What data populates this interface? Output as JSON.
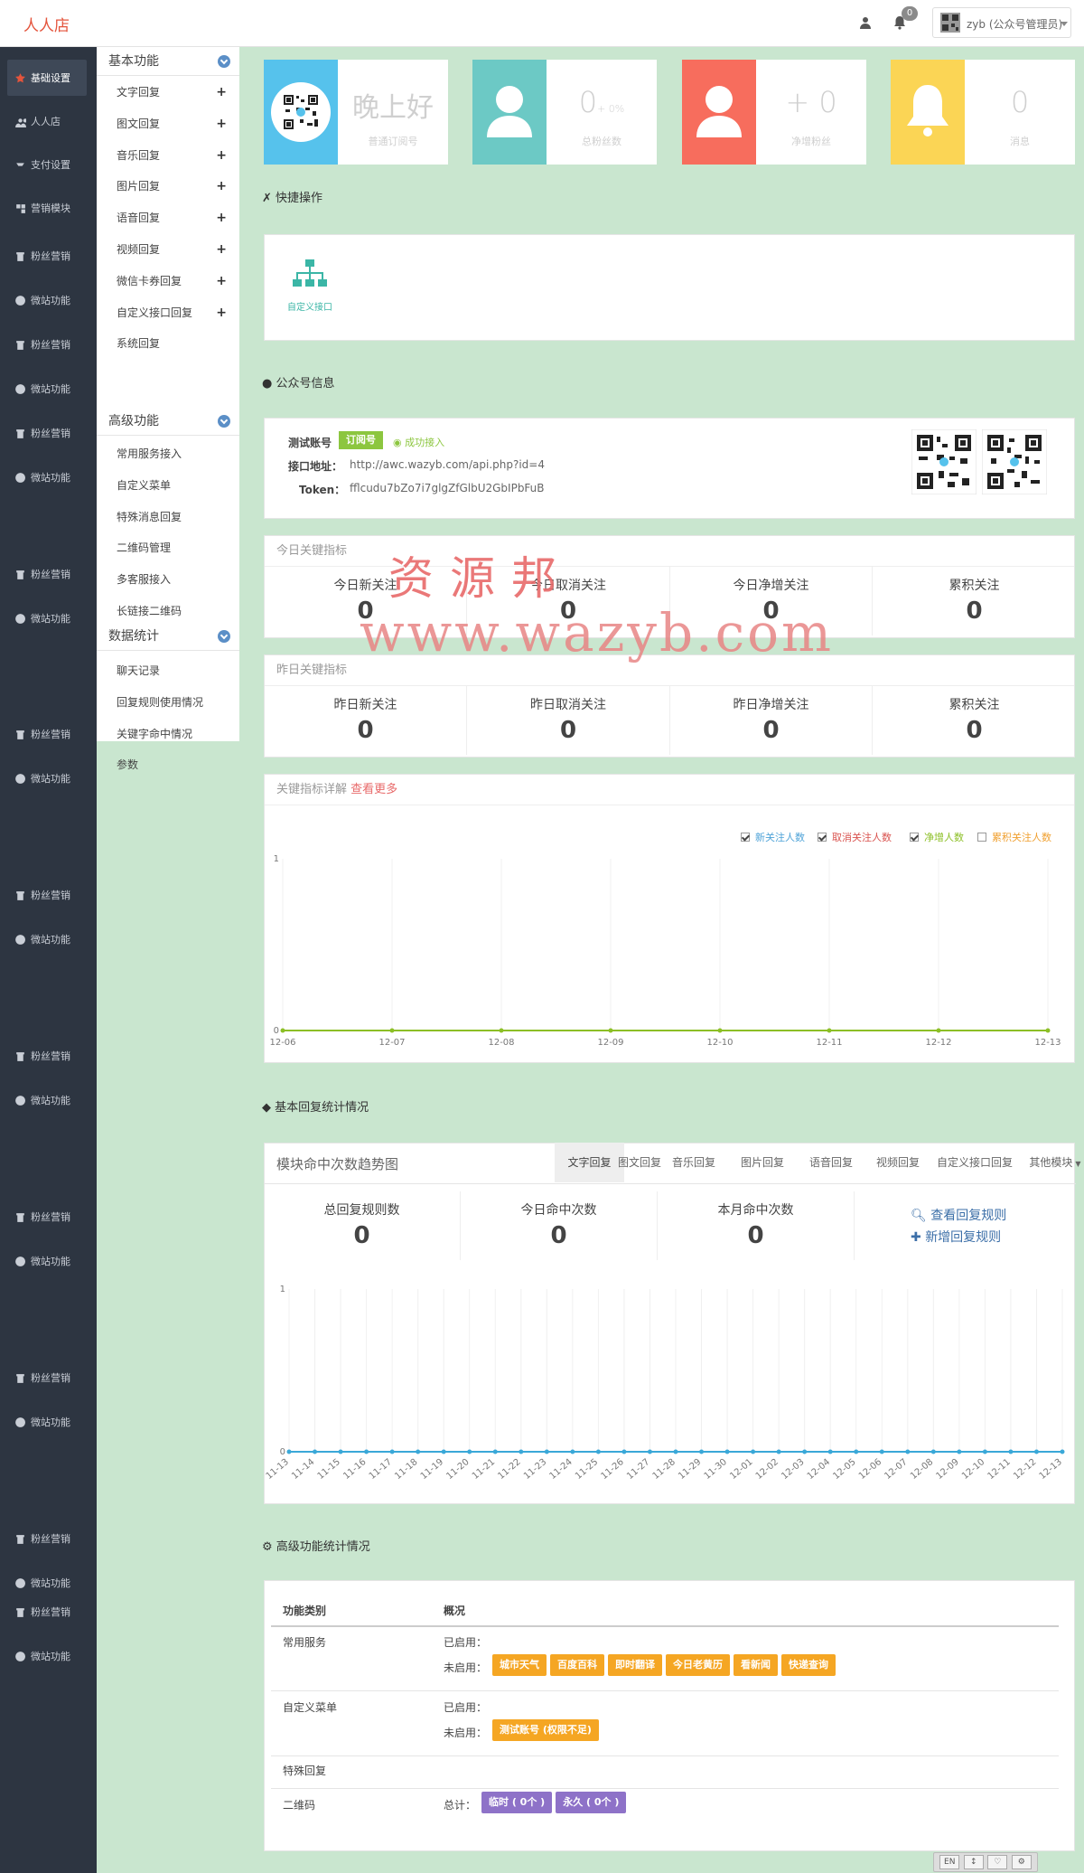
{
  "brand": "人人店",
  "header": {
    "notifications": "0",
    "user": "zyb (公众号管理员)"
  },
  "sidebar": {
    "items": [
      "基础设置",
      "人人店",
      "支付设置",
      "营销模块",
      "粉丝营销",
      "微站功能",
      "粉丝营销",
      "微站功能",
      "粉丝营销",
      "微站功能",
      "粉丝营销",
      "微站功能",
      "粉丝营销",
      "微站功能",
      "粉丝营销",
      "微站功能",
      "粉丝营销",
      "微站功能",
      "粉丝营销",
      "微站功能",
      "粉丝营销",
      "微站功能",
      "粉丝营销",
      "微站功能",
      "粉丝营销",
      "微站功能"
    ]
  },
  "submenu": {
    "groups": [
      {
        "title": "基本功能",
        "items": [
          "文字回复",
          "图文回复",
          "音乐回复",
          "图片回复",
          "语音回复",
          "视频回复",
          "微信卡券回复",
          "自定义接口回复",
          "系统回复"
        ]
      },
      {
        "title": "高级功能",
        "items": [
          "常用服务接入",
          "自定义菜单",
          "特殊消息回复",
          "二维码管理",
          "多客服接入",
          "长链接二维码"
        ]
      },
      {
        "title": "数据统计",
        "items": [
          "聊天记录",
          "回复规则使用情况",
          "关键字命中情况",
          "参数"
        ]
      }
    ]
  },
  "cards": {
    "greeting": {
      "value": "晚上好",
      "label": "普通订阅号"
    },
    "fans": {
      "value": "0",
      "sub": "+ 0%",
      "label": "总粉丝数"
    },
    "net": {
      "value": "+ 0",
      "label": "净增粉丝"
    },
    "msg": {
      "value": "0",
      "label": "消息"
    },
    "colors": {
      "blue": "#56c2ec",
      "teal": "#6cc9c5",
      "red": "#f76d5d",
      "yellow": "#fbd555"
    }
  },
  "quick": {
    "title": "快捷操作",
    "item": "自定义接口"
  },
  "account": {
    "title": "公众号信息",
    "name_label": "测试账号",
    "type_badge": "订阅号",
    "status": "成功接入",
    "url_label": "接口地址：",
    "url": "http://awc.wazyb.com/api.php?id=4",
    "token_label": "Token：",
    "token": "fflcudu7bZo7i7glgZfGlbU2GbIPbFuB"
  },
  "watermark": {
    "line1": "资源邦",
    "line2": "www.wazyb.com"
  },
  "today": {
    "title": "今日关键指标",
    "items": [
      {
        "label": "今日新关注",
        "value": "0"
      },
      {
        "label": "今日取消关注",
        "value": "0"
      },
      {
        "label": "今日净增关注",
        "value": "0"
      },
      {
        "label": "累积关注",
        "value": "0"
      }
    ]
  },
  "yesterday": {
    "title": "昨日关键指标",
    "items": [
      {
        "label": "昨日新关注",
        "value": "0"
      },
      {
        "label": "昨日取消关注",
        "value": "0"
      },
      {
        "label": "昨日净增关注",
        "value": "0"
      },
      {
        "label": "累积关注",
        "value": "0"
      }
    ]
  },
  "detail": {
    "title": "关键指标详解",
    "more": "查看更多",
    "legend": [
      {
        "label": "新关注人数",
        "checked": true,
        "color": "#4fa3d8"
      },
      {
        "label": "取消关注人数",
        "checked": true,
        "color": "#d9534f"
      },
      {
        "label": "净增人数",
        "checked": true,
        "color": "#8cbf26"
      },
      {
        "label": "累积关注人数",
        "checked": false,
        "color": "#f0a030"
      }
    ]
  },
  "reply_stats": {
    "section_title": "基本回复统计情况",
    "panel_title": "模块命中次数趋势图",
    "tabs": [
      "文字回复",
      "图文回复",
      "音乐回复",
      "图片回复",
      "语音回复",
      "视频回复",
      "自定义接口回复",
      "其他模块"
    ],
    "cells": [
      {
        "label": "总回复规则数",
        "value": "0"
      },
      {
        "label": "今日命中次数",
        "value": "0"
      },
      {
        "label": "本月命中次数",
        "value": "0"
      }
    ],
    "links": [
      "查看回复规则",
      "新增回复规则"
    ]
  },
  "advanced": {
    "title": "高级功能统计情况",
    "col1": "功能类别",
    "col2": "概况",
    "rows": [
      {
        "category": "常用服务",
        "enabled_label": "已启用：",
        "disabled_label": "未启用：",
        "tags": [
          "城市天气",
          "百度百科",
          "即时翻译",
          "今日老黄历",
          "看新闻",
          "快递查询"
        ]
      },
      {
        "category": "自定义菜单",
        "enabled_label": "已启用：",
        "disabled_label": "未启用：",
        "tags": [
          "测试账号 (权限不足)"
        ]
      },
      {
        "category": "特殊回复"
      },
      {
        "category": "二维码",
        "total_label": "总计：",
        "tags": [
          "临时 ( 0个 )",
          "永久 ( 0个 )"
        ]
      }
    ]
  },
  "footer_tools": [
    "EN",
    "↕",
    "♡",
    "⚙"
  ],
  "chart_data": [
    {
      "type": "line",
      "x": [
        "12-06",
        "12-07",
        "12-08",
        "12-09",
        "12-10",
        "12-11",
        "12-12",
        "12-13"
      ],
      "series": [
        {
          "name": "净增人数",
          "values": [
            0,
            0,
            0,
            0,
            0,
            0,
            0,
            0
          ]
        }
      ],
      "ylim": [
        0,
        1
      ],
      "yticks": [
        "0",
        "1"
      ],
      "grid": true,
      "legend": "top-right"
    },
    {
      "type": "line",
      "x": [
        "11-13",
        "11-14",
        "11-15",
        "11-16",
        "11-17",
        "11-18",
        "11-19",
        "11-20",
        "11-21",
        "11-22",
        "11-23",
        "11-24",
        "11-25",
        "11-26",
        "11-27",
        "11-28",
        "11-29",
        "11-30",
        "12-01",
        "12-02",
        "12-03",
        "12-04",
        "12-05",
        "12-06",
        "12-07",
        "12-08",
        "12-09",
        "12-10",
        "12-11",
        "12-12",
        "12-13"
      ],
      "series": [
        {
          "values": [
            0,
            0,
            0,
            0,
            0,
            0,
            0,
            0,
            0,
            0,
            0,
            0,
            0,
            0,
            0,
            0,
            0,
            0,
            0,
            0,
            0,
            0,
            0,
            0,
            0,
            0,
            0,
            0,
            0,
            0,
            0
          ]
        }
      ],
      "ylim": [
        0,
        1
      ],
      "yticks": [
        "0",
        "1"
      ],
      "grid": true
    }
  ]
}
